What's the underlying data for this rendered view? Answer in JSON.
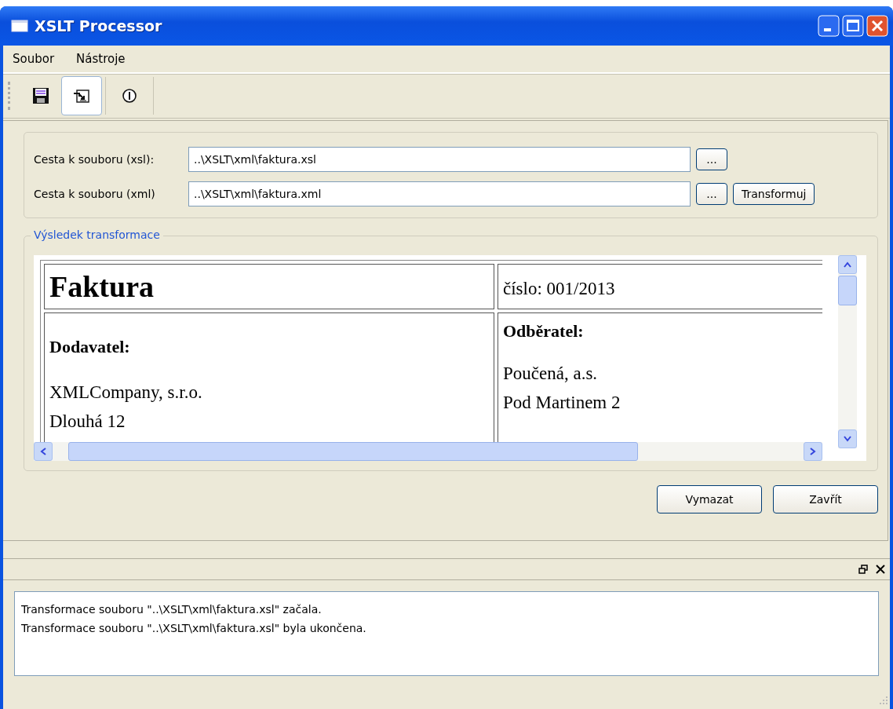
{
  "window": {
    "title": "XSLT Processor"
  },
  "menu": [
    {
      "label": "Soubor"
    },
    {
      "label": "Nástroje"
    }
  ],
  "toolbar": [
    {
      "kind": "save",
      "selected": false
    },
    {
      "kind": "transform",
      "selected": true
    },
    {
      "kind": "info",
      "selected": false
    }
  ],
  "inputs": [
    {
      "label": "Cesta k souboru (xsl):",
      "value": "..\\XSLT\\xml\\faktura.xsl",
      "browse": "..."
    },
    {
      "label": "Cesta k souboru (xml)",
      "value": "..\\XSLT\\xml\\faktura.xml",
      "browse": "...",
      "action": "Transformuj"
    }
  ],
  "result": {
    "title": "Výsledek transformace",
    "document": {
      "heading": "Faktura",
      "number": "číslo: 001/2013",
      "supplier": {
        "title": "Dodavatel:",
        "lines": [
          "XMLCompany, s.r.o.",
          "Dlouhá 12"
        ]
      },
      "customer": {
        "title": "Odběratel:",
        "lines": [
          "Poučená, a.s.",
          "Pod Martinem 2"
        ]
      }
    }
  },
  "buttons": [
    {
      "label": "Vymazat"
    },
    {
      "label": "Zavřít"
    }
  ],
  "log": {
    "lines": [
      "Transformace souboru \"..\\XSLT\\xml\\faktura.xsl\" začala.",
      "Transformace souboru \"..\\XSLT\\xml\\faktura.xsl\" byla ukončena."
    ]
  }
}
